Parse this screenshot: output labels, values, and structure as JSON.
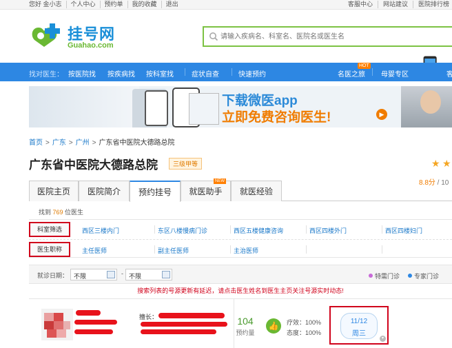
{
  "topbar": {
    "left": [
      "您好 金小志",
      "个人中心",
      "预约单",
      "我的收藏",
      "退出"
    ],
    "right": [
      "客服中心",
      "网站建议",
      "医院排行榜"
    ]
  },
  "logo": {
    "cn": "挂号网",
    "en": "Guahao.com"
  },
  "search": {
    "placeholder": "请输入疾病名、科室名、医院名或医生名"
  },
  "nav": {
    "find_label": "找对医生：",
    "items": [
      "按医院找",
      "按疾病找",
      "按科室找",
      "症状自查",
      "快速预约"
    ],
    "right_items": [
      "名医之旅",
      "母婴专区"
    ],
    "hot_tag": "HOT",
    "app_label": "客"
  },
  "banner": {
    "line1": "下载微医app",
    "line2": "立即免费咨询医生!",
    "arrow": "▶"
  },
  "breadcrumb": {
    "items": [
      "首页",
      "广东",
      "广州"
    ],
    "current": "广东省中医院大德路总院",
    "sep": ">"
  },
  "hospital": {
    "name": "广东省中医院大德路总院",
    "level": "三级甲等",
    "score_value": "8.8分",
    "score_rest": " / 10"
  },
  "tabs": {
    "items": [
      "医院主页",
      "医院简介",
      "预约挂号",
      "就医助手",
      "就医经验"
    ],
    "new_tag": "NEW"
  },
  "found": {
    "prefix": "找到 ",
    "count": "769",
    "suffix": " 位医生"
  },
  "filter": {
    "dept_label": "科室筛选",
    "title_label": "医生职称",
    "depts": [
      "西区三楼内门",
      "东区八楼慢病门诊",
      "西区五楼健康咨询",
      "西区四楼外门",
      "西区四楼妇门"
    ],
    "titles": [
      "主任医师",
      "副主任医师",
      "主治医师"
    ]
  },
  "datebar": {
    "label": "就诊日期：",
    "from": "不限",
    "to": "不限",
    "dash": "-",
    "legend": [
      {
        "label": "特需门诊",
        "color": "#c86ad8"
      },
      {
        "label": "专家门诊",
        "color": "#2d87e3"
      }
    ]
  },
  "notice": "搜索列表的号源更新有延迟，请点击医生姓名到医生主页关注号源实时动态!",
  "doctor": {
    "spec_label": "擅长：",
    "count": "104",
    "count_label": "预约量",
    "efficacy": "疗效：100%",
    "attitude": "态度：100%",
    "slot_date": "11/12",
    "slot_weekday": "周三"
  },
  "colors": {
    "brand_blue": "#2d87e3",
    "brand_green": "#6ab833",
    "highlight_red": "#d0021b"
  }
}
